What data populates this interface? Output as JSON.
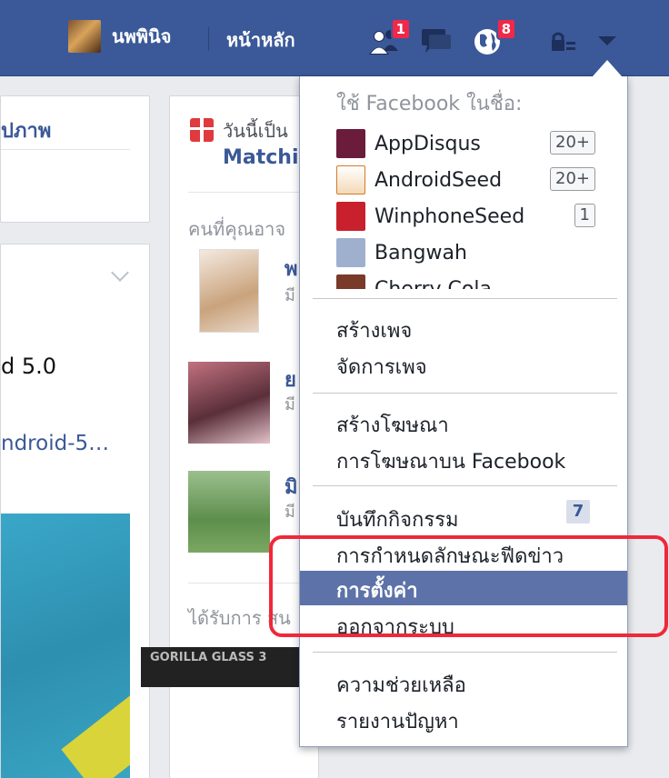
{
  "topbar": {
    "profile_name": "นพพินิจ",
    "home_label": "หน้าหลัก",
    "friend_requests_badge": "1",
    "notifications_badge": "8",
    "brand_color": "#3b5998"
  },
  "background": {
    "left_card_label": "ปภาพ",
    "post_text": "d 5.0",
    "post_link": "ndroid-5…",
    "today_text": "วันนี้เป็น",
    "event_name": "Matchi",
    "people_heading": "คนที่คุณอาจ",
    "people": [
      {
        "name": "พ",
        "mutual": "มี"
      },
      {
        "name": "ย",
        "mutual": "มี"
      },
      {
        "name": "มิ",
        "mutual": "มี"
      }
    ],
    "received_heading": "ได้รับการ สน",
    "ad_text": "GORILLA GLASS 3"
  },
  "menu": {
    "use_as_heading": "ใช้ Facebook ในชื่อ:",
    "pages": [
      {
        "name": "AppDisqus",
        "count": "20+",
        "icon_color": "#6a1c3a"
      },
      {
        "name": "AndroidSeed",
        "count": "20+",
        "icon_color": "#d47a2a"
      },
      {
        "name": "WinphoneSeed",
        "count": "1",
        "icon_color": "#c8202c"
      },
      {
        "name": "Bangwah",
        "count": "",
        "icon_color": "#9fb0cf"
      },
      {
        "name": "Cherry Cola",
        "count": "",
        "icon_color": "#7a3a2a"
      }
    ],
    "create_page": "สร้างเพจ",
    "manage_pages": "จัดการเพจ",
    "create_ad": "สร้างโฆษณา",
    "advertising": "การโฆษณาบน Facebook",
    "activity_log": "บันทึกกิจกรรม",
    "activity_log_count": "7",
    "news_feed_prefs": "การกำหนดลักษณะฟีดข่าว",
    "settings": "การตั้งค่า",
    "logout": "ออกจากระบบ",
    "help": "ความช่วยเหลือ",
    "report_problem": "รายงานปัญหา",
    "highlight_color": "#5d72a8",
    "annotation_color": "#f0283a"
  }
}
